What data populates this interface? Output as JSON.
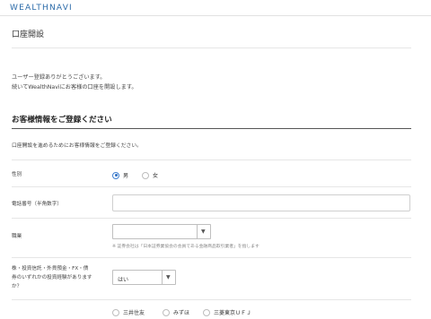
{
  "header": {
    "logo": "WEALTHNAVI"
  },
  "page": {
    "title": "口座開設"
  },
  "intro": {
    "line1": "ユーザー登録ありがとうございます。",
    "line2": "続いてWealthNaviにお客様の口座を開設します。"
  },
  "section": {
    "title": "お客様情報をご登録ください",
    "description": "口座開設を進めるためにお客様情報をご登録ください。"
  },
  "form": {
    "gender": {
      "label": "性別",
      "options": [
        {
          "label": "男",
          "selected": true
        },
        {
          "label": "女",
          "selected": false
        }
      ]
    },
    "phone": {
      "label": "電話番号（半角数字）",
      "value": ""
    },
    "occupation": {
      "label": "職業",
      "value": "",
      "note": "※ 証券会社は「日本証券業協会の会員である金融商品取引業者」を指します"
    },
    "investment_experience": {
      "label_line1": "株・投資信託・外貨預金・FX・債",
      "label_line2": "券のいずれかの投資経験があります",
      "label_line3": "か？",
      "value": "はい"
    },
    "banks": {
      "options": [
        "三井住友",
        "みずほ",
        "三菱東京ＵＦＪ"
      ]
    }
  },
  "colors": {
    "accent": "#2f6fc2",
    "logo": "#2a6aa8"
  }
}
